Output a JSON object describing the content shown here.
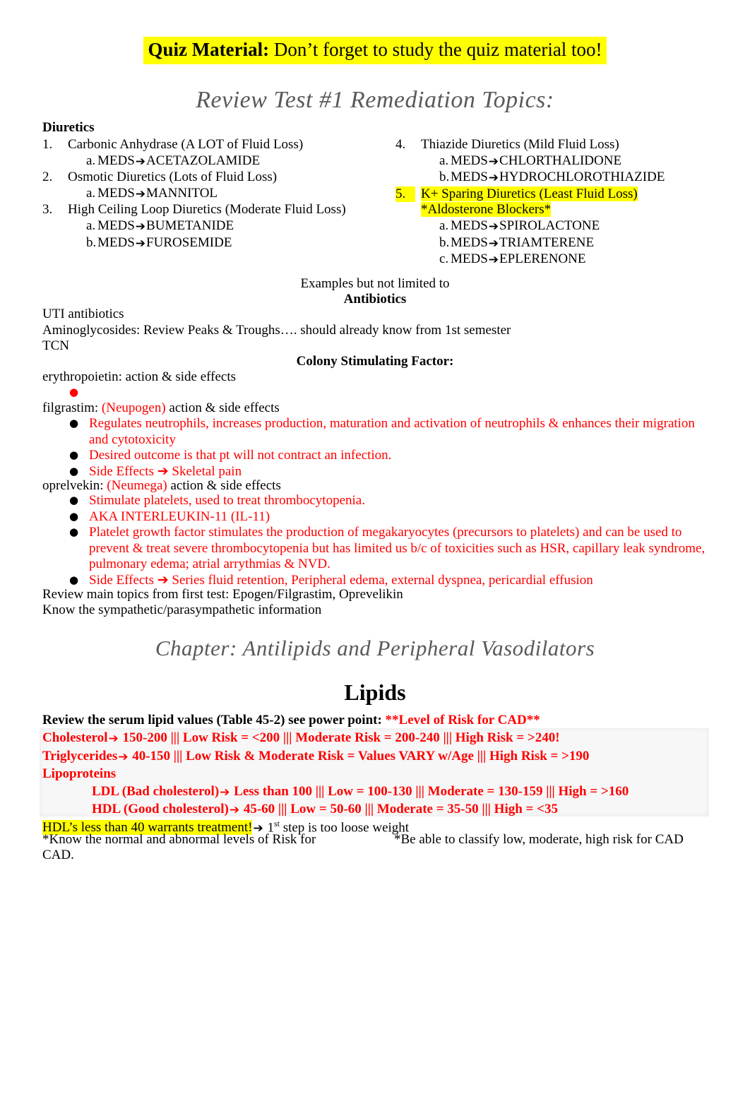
{
  "banner": {
    "lead": "Quiz Material:",
    "text": "  Don’t forget to study the quiz material too!",
    "highlight_color": "#ffff00"
  },
  "headings": {
    "review_test": "Review Test #1 Remediation Topics:",
    "chapter": "Chapter: Antilipids and Peripheral Vasodilators",
    "lipids": "Lipids",
    "heading_color": "#595959"
  },
  "diuretics": {
    "label": "Diuretics",
    "left_column": [
      {
        "marker": "1.",
        "text": "Carbonic Anhydrase (A LOT of Fluid Loss)",
        "subs": [
          {
            "marker": "a.",
            "prefix": "MEDS",
            "arrow": "➔",
            "drug": "ACETAZOLAMIDE"
          }
        ]
      },
      {
        "marker": "2.",
        "text": "Osmotic Diuretics (Lots of Fluid Loss)",
        "subs": [
          {
            "marker": "a.",
            "prefix": "MEDS",
            "arrow": "➔",
            "drug": "MANNITOL"
          }
        ]
      },
      {
        "marker": "3.",
        "text": "High Ceiling Loop Diuretics (Moderate Fluid Loss)",
        "subs": [
          {
            "marker": "a.",
            "prefix": "MEDS",
            "arrow": "➔",
            "drug": "BUMETANIDE"
          },
          {
            "marker": "b.",
            "prefix": "MEDS",
            "arrow": "➔",
            "drug": "FUROSEMIDE"
          }
        ]
      }
    ],
    "right_column": [
      {
        "marker": "4.",
        "text": "Thiazide Diuretics (Mild Fluid Loss)",
        "subs": [
          {
            "marker": "a.",
            "prefix": "MEDS",
            "arrow": "➔",
            "drug": "CHLORTHALIDONE"
          },
          {
            "marker": "b.",
            "prefix": "MEDS",
            "arrow": "➔",
            "drug": "HYDROCHLOROTHIAZIDE"
          }
        ]
      },
      {
        "marker": "5.",
        "text": "K+ Sparing Diuretics (Least Fluid Loss)",
        "highlighted": true,
        "note": "*Aldosterone Blockers*",
        "subs": [
          {
            "marker": "a.",
            "prefix": "MEDS",
            "arrow": "➔",
            "drug": "SPIROLACTONE"
          },
          {
            "marker": "b.",
            "prefix": "MEDS",
            "arrow": "➔",
            "drug": "TRIAMTERENE"
          },
          {
            "marker": "c.",
            "prefix": "MEDS",
            "arrow": "➔",
            "drug": "EPLERENONE"
          }
        ]
      }
    ]
  },
  "antibiotics": {
    "examples_note": "Examples but not limited to",
    "title": "Antibiotics",
    "line1": "UTI antibiotics",
    "line2": "Aminoglycosides: Review Peaks & Troughs…. should already know from 1st semester",
    "line3": "TCN"
  },
  "csf": {
    "title": "Colony Stimulating Factor:",
    "erythropoietin": "erythropoietin: action & side effects",
    "filgrastim_prefix": "filgrastim: ",
    "filgrastim_brand": "(Neupogen)",
    "filgrastim_suffix": " action & side effects",
    "filgrastim_bullets": [
      "Regulates neutrophils, increases production, maturation and activation of neutrophils & enhances their migration and cytotoxicity",
      "Desired outcome is that pt will not contract an infection.",
      "Side Effects ➔ Skeletal pain"
    ],
    "oprelvekin_prefix": "oprelvekin: ",
    "oprelvekin_brand": "(Neumega)",
    "oprelvekin_suffix": " action & side effects",
    "oprelvekin_bullets": [
      "Stimulate platelets, used to treat thrombocytopenia.",
      "AKA INTERLEUKIN-11 (IL-11)",
      "Platelet growth factor stimulates the production of megakaryocytes (precursors to platelets) and can be used to prevent & treat severe thrombocytopenia but has limited us b/c of toxicities such as HSR, capillary leak syndrome, pulmonary edema; atrial arrythmias & NVD.",
      "Side Effects ➔ Series fluid retention, Peripheral edema, external dyspnea, pericardial effusion"
    ],
    "review_main": "Review main topics from first test: Epogen/Filgrastim, Oprevelikin",
    "know_symp": "Know the sympathetic/parasympathetic information",
    "red_color": "#ff0000"
  },
  "lipids": {
    "intro_black": "Review the serum lipid values (Table 45-2) see power point: ",
    "intro_red": "**Level of Risk for CAD**",
    "rows": [
      {
        "label": "Cholesterol",
        "arrow": "➔",
        "values": " 150-200  |||  Low Risk = <200  |||  Moderate Risk = 200-240  |||  High Risk = >240!",
        "indent": false
      },
      {
        "label": "Triglycerides",
        "arrow": "➔",
        "values": " 40-150  |||  Low Risk & Moderate Risk = Values VARY w/Age  |||  High Risk = >190",
        "indent": false
      },
      {
        "label": "Lipoproteins",
        "arrow": "",
        "values": "",
        "indent": false
      },
      {
        "label": "LDL (Bad cholesterol)",
        "arrow": "➔",
        "values": " Less than 100 ||| Low = 100-130 ||| Moderate = 130-159 ||| High = >160",
        "indent": true
      },
      {
        "label": "HDL (Good cholesterol)",
        "arrow": "➔",
        "values": " 45-60 ||| Low = 50-60 ||| Moderate = 35-50 |||  High = <35",
        "indent": true
      }
    ],
    "hdl_warning_highlighted": "HDL’s less than  40 warrants treatment!",
    "hdl_warning_arrow": "➔",
    "hdl_warning_rest_pre": " 1",
    "hdl_warning_rest_sup": "st",
    "hdl_warning_rest_post": " step is too loose weight",
    "know_levels": "*Know the normal and abnormal levels of Risk for",
    "cad_continuation": "CAD.",
    "classify_note": "*Be able to classify low, moderate, high risk for CAD"
  }
}
